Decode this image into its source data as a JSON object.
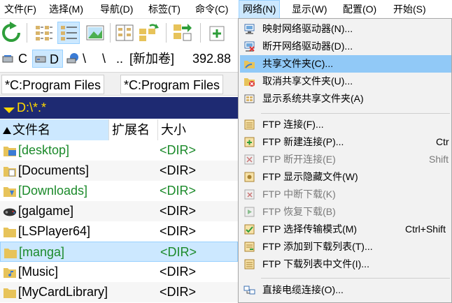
{
  "menubar": {
    "items": [
      "文件(F)",
      "选择(M)",
      "导航(D)",
      "标签(T)",
      "命令(C)",
      "网络(N)",
      "显示(W)",
      "配置(O)",
      "开始(S)"
    ]
  },
  "toolbar": {
    "icons": [
      "refresh-icon",
      "brief-view-icon",
      "detail-view-icon",
      "thumbnail-view-icon",
      "tree-view-icon",
      "sync-dirs-icon",
      "copy-to-target-icon",
      "add-icon"
    ]
  },
  "drivebar": {
    "c_label": "C",
    "d_label": "D",
    "backslash": "\\",
    "parent": "..",
    "volume": "[新加卷]",
    "free_space": "392.88"
  },
  "tabs": [
    "*C:Program Files",
    "*C:Program Files"
  ],
  "path": "D:\\*.*",
  "columns": {
    "name": "文件名",
    "ext": "扩展名",
    "size": "大小"
  },
  "files": [
    {
      "name": "[desktop]",
      "type": "<DIR>",
      "icon": "desktop-folder-icon"
    },
    {
      "name": "[Documents]",
      "type": "<DIR>",
      "icon": "documents-folder-icon"
    },
    {
      "name": "[Downloads]",
      "type": "<DIR>",
      "icon": "downloads-folder-icon"
    },
    {
      "name": "[galgame]",
      "type": "<DIR>",
      "icon": "gamepad-folder-icon"
    },
    {
      "name": "[LSPlayer64]",
      "type": "<DIR>",
      "icon": "folder-icon"
    },
    {
      "name": "[manga]",
      "type": "<DIR>",
      "icon": "folder-icon"
    },
    {
      "name": "[Music]",
      "type": "<DIR>",
      "icon": "music-folder-icon"
    },
    {
      "name": "[MyCardLibrary]",
      "type": "<DIR>",
      "icon": "folder-icon"
    }
  ],
  "network_menu": {
    "items": [
      {
        "label": "映射网络驱动器(N)...",
        "shortcut": "",
        "icon": "map-drive-icon"
      },
      {
        "label": "断开网络驱动器(D)...",
        "shortcut": "",
        "icon": "disconnect-drive-icon"
      },
      {
        "label": "共享文件夹(C)...",
        "shortcut": "",
        "icon": "share-folder-icon"
      },
      {
        "label": "取消共享文件夹(U)...",
        "shortcut": "",
        "icon": "unshare-folder-icon"
      },
      {
        "label": "显示系统共享文件夹(A)",
        "shortcut": "",
        "icon": "system-shares-icon"
      },
      {
        "label": "FTP 连接(F)...",
        "shortcut": "",
        "icon": "ftp-connect-icon"
      },
      {
        "label": "FTP 新建连接(P)...",
        "shortcut": "Ctr",
        "icon": "ftp-new-connection-icon"
      },
      {
        "label": "FTP 断开连接(E)",
        "shortcut": "Shift",
        "icon": "ftp-disconnect-icon"
      },
      {
        "label": "FTP 显示隐藏文件(W)",
        "shortcut": "",
        "icon": "ftp-show-hidden-icon"
      },
      {
        "label": "FTP 中断下载(K)",
        "shortcut": "",
        "icon": "ftp-abort-download-icon"
      },
      {
        "label": "FTP 恢复下载(B)",
        "shortcut": "",
        "icon": "ftp-resume-download-icon"
      },
      {
        "label": "FTP 选择传输模式(M)",
        "shortcut": "Ctrl+Shift",
        "icon": "ftp-transfer-mode-icon"
      },
      {
        "label": "FTP 添加到下载列表(T)...",
        "shortcut": "",
        "icon": "ftp-add-download-list-icon"
      },
      {
        "label": "FTP 下载列表中文件(I)...",
        "shortcut": "",
        "icon": "ftp-download-list-icon"
      },
      {
        "label": "直接电缆连接(O)...",
        "shortcut": "",
        "icon": "cable-connection-icon"
      }
    ]
  }
}
